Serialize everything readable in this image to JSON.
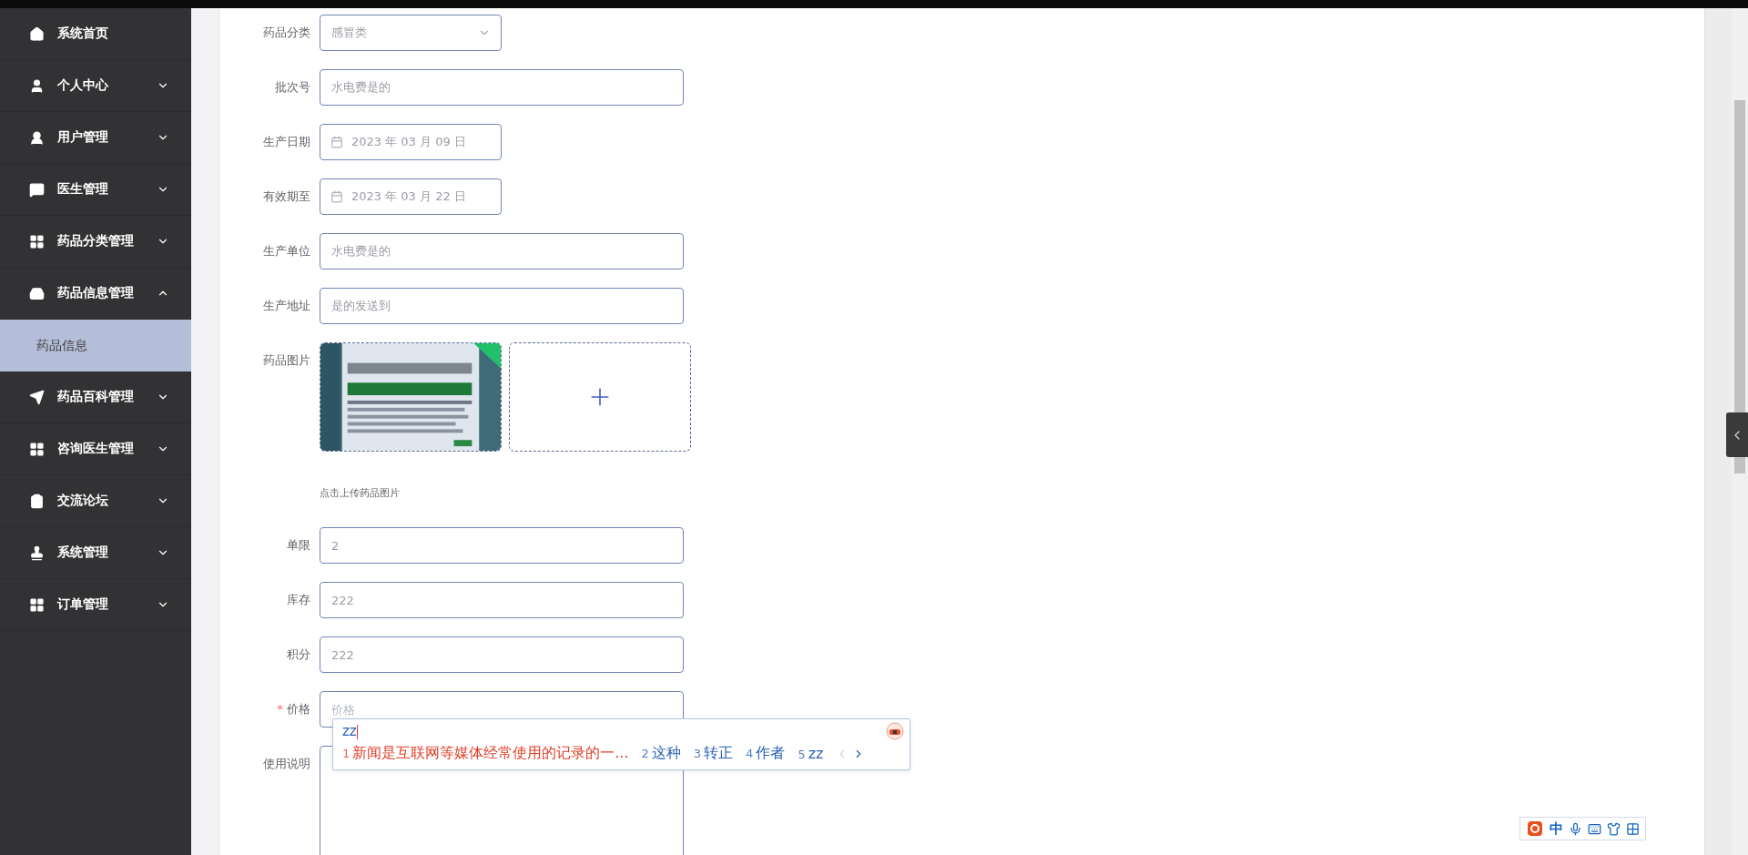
{
  "sidebar": {
    "items": [
      {
        "label": "系统首页",
        "kind": "link"
      },
      {
        "label": "个人中心",
        "kind": "submenu",
        "expanded": false
      },
      {
        "label": "用户管理",
        "kind": "submenu",
        "expanded": false
      },
      {
        "label": "医生管理",
        "kind": "submenu",
        "expanded": false
      },
      {
        "label": "药品分类管理",
        "kind": "submenu",
        "expanded": false
      },
      {
        "label": "药品信息管理",
        "kind": "submenu",
        "expanded": true,
        "children": [
          {
            "label": "药品信息",
            "selected": true
          }
        ]
      },
      {
        "label": "药品百科管理",
        "kind": "submenu",
        "expanded": false
      },
      {
        "label": "咨询医生管理",
        "kind": "submenu",
        "expanded": false
      },
      {
        "label": "交流论坛",
        "kind": "submenu",
        "expanded": false
      },
      {
        "label": "系统管理",
        "kind": "submenu",
        "expanded": false
      },
      {
        "label": "订单管理",
        "kind": "submenu",
        "expanded": false
      }
    ]
  },
  "form": {
    "fields": [
      {
        "label": "药品分类",
        "kind": "select",
        "value": "感冒类"
      },
      {
        "label": "批次号",
        "kind": "text",
        "value": "水电费是的"
      },
      {
        "label": "生产日期",
        "kind": "date",
        "value": "2023 年 03 月 09 日"
      },
      {
        "label": "有效期至",
        "kind": "date",
        "value": "2023 年 03 月 22 日"
      },
      {
        "label": "生产单位",
        "kind": "text",
        "value": "水电费是的"
      },
      {
        "label": "生产地址",
        "kind": "text",
        "value": "是的发送到"
      },
      {
        "label": "药品图片",
        "kind": "upload",
        "hint": "点击上传药品图片"
      },
      {
        "label": "单限",
        "kind": "text",
        "value": "2"
      },
      {
        "label": "库存",
        "kind": "text",
        "value": "222"
      },
      {
        "label": "积分",
        "kind": "text",
        "value": "222"
      },
      {
        "label": "价格",
        "kind": "text",
        "placeholder": "价格",
        "required_mark": "*"
      },
      {
        "label": "使用说明",
        "kind": "textarea"
      }
    ]
  },
  "ime_popup": {
    "composition": "zz",
    "candidates": [
      {
        "index": "1",
        "text": "新闻是互联网等媒体经常使用的记录的一...",
        "selected": true
      },
      {
        "index": "2",
        "text": "这种",
        "selected": false
      },
      {
        "index": "3",
        "text": "转正",
        "selected": false
      },
      {
        "index": "4",
        "text": "作者",
        "selected": false
      },
      {
        "index": "5",
        "text": "zz",
        "selected": false
      }
    ],
    "prev_page": {
      "disabled": true
    },
    "next_page": {
      "disabled": false
    }
  },
  "ime_toolbar": {
    "mode": "中"
  }
}
